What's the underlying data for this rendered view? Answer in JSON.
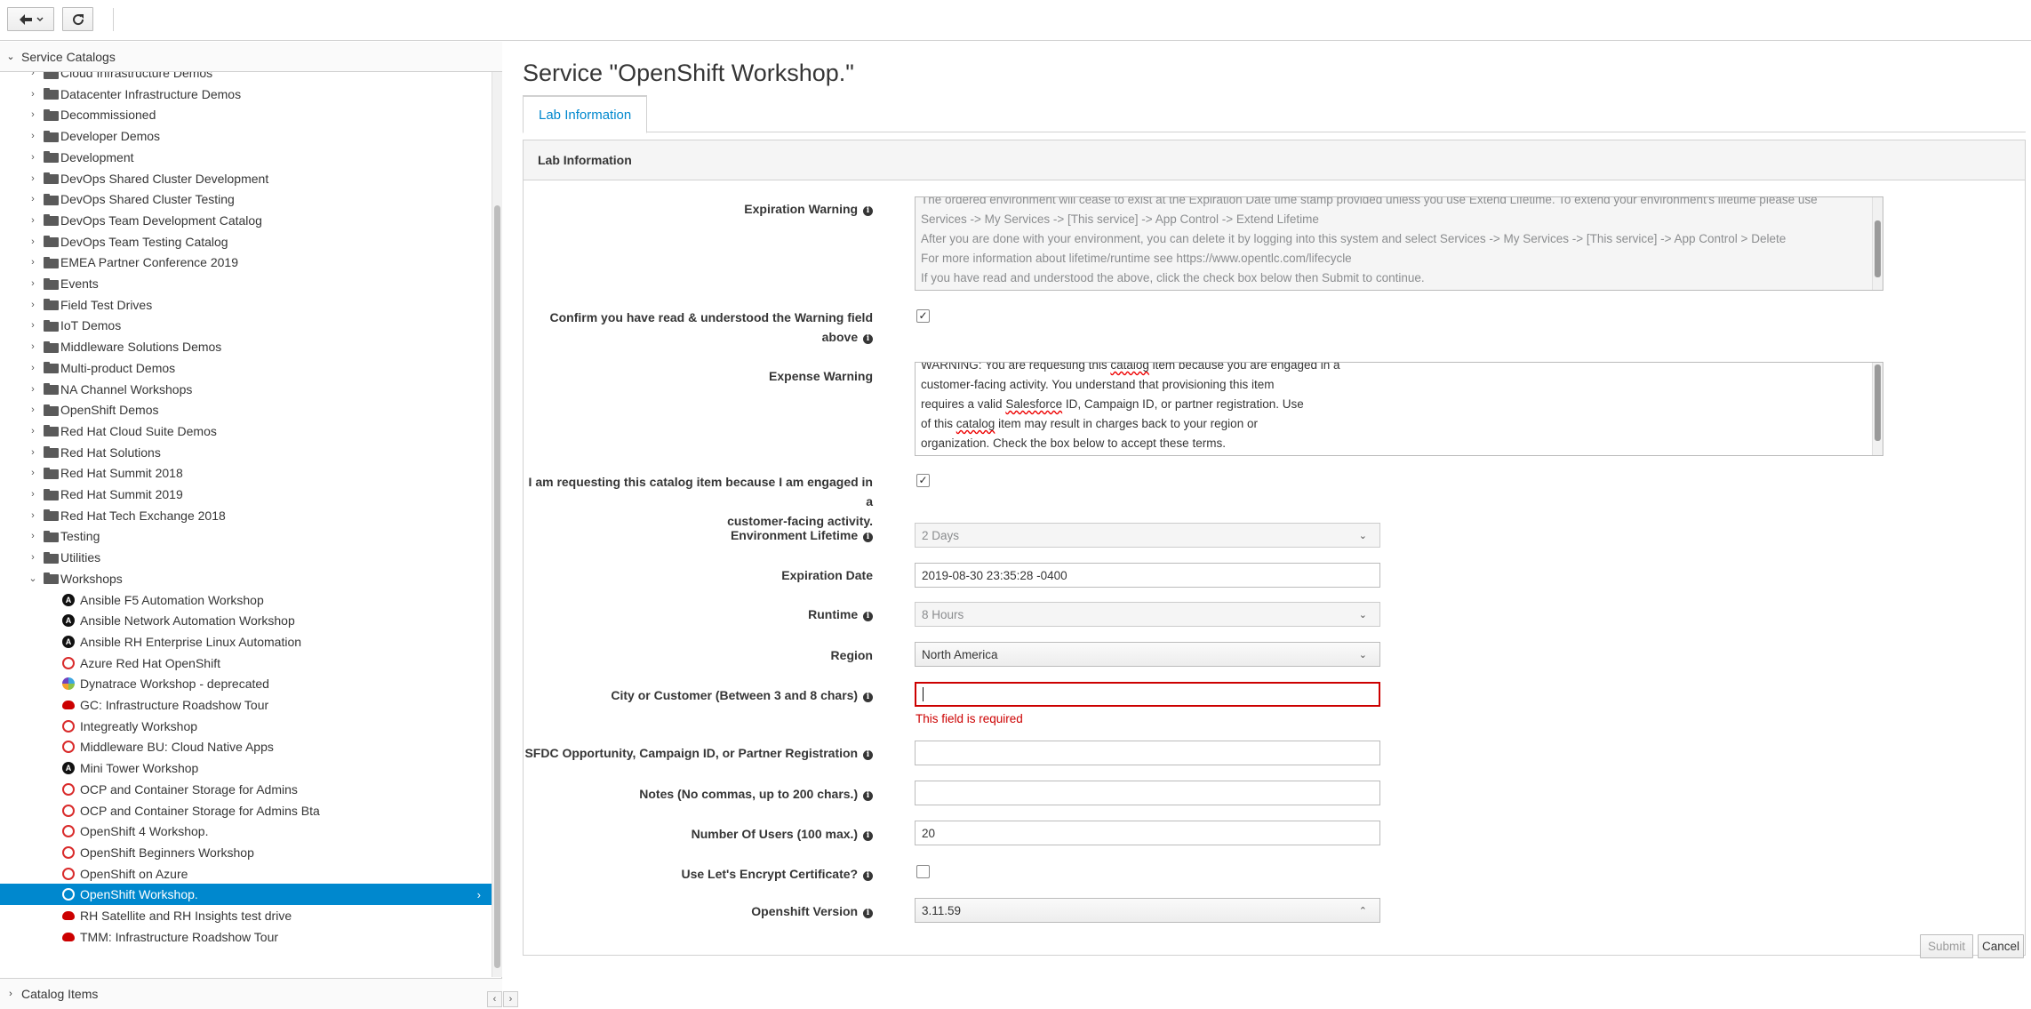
{
  "toolbar": {
    "back_icon": "arrow-left-icon",
    "refresh_icon": "refresh-icon"
  },
  "sidebar": {
    "accordion_title": "Service Catalogs",
    "tree_folders": [
      "Cloud Infrastructure Demos",
      "Datacenter Infrastructure Demos",
      "Decommissioned",
      "Developer Demos",
      "Development",
      "DevOps Shared Cluster Development",
      "DevOps Shared Cluster Testing",
      "DevOps Team Development Catalog",
      "DevOps Team Testing Catalog",
      "EMEA Partner Conference 2019",
      "Events",
      "Field Test Drives",
      "IoT Demos",
      "Middleware Solutions Demos",
      "Multi-product Demos",
      "NA Channel Workshops",
      "OpenShift Demos",
      "Red Hat Cloud Suite Demos",
      "Red Hat Solutions",
      "Red Hat Summit 2018",
      "Red Hat Summit 2019",
      "Red Hat Tech Exchange 2018",
      "Testing",
      "Utilities",
      "Workshops"
    ],
    "workshop_items": [
      {
        "label": "Ansible F5 Automation Workshop",
        "icon": "ansible"
      },
      {
        "label": "Ansible Network Automation Workshop",
        "icon": "ansible"
      },
      {
        "label": "Ansible RH Enterprise Linux Automation",
        "icon": "ansible"
      },
      {
        "label": "Azure Red Hat OpenShift",
        "icon": "openshift"
      },
      {
        "label": "Dynatrace Workshop - deprecated",
        "icon": "dyna"
      },
      {
        "label": "GC: Infrastructure Roadshow Tour",
        "icon": "hat"
      },
      {
        "label": "Integreatly Workshop",
        "icon": "openshift"
      },
      {
        "label": "Middleware BU: Cloud Native Apps",
        "icon": "openshift"
      },
      {
        "label": "Mini Tower Workshop",
        "icon": "ansible"
      },
      {
        "label": "OCP and Container Storage for Admins",
        "icon": "openshift"
      },
      {
        "label": "OCP and Container Storage for Admins Bta",
        "icon": "openshift"
      },
      {
        "label": "OpenShift 4 Workshop.",
        "icon": "openshift"
      },
      {
        "label": "OpenShift Beginners Workshop",
        "icon": "openshift"
      },
      {
        "label": "OpenShift on Azure",
        "icon": "openshift"
      },
      {
        "label": "OpenShift Workshop.",
        "icon": "openshift",
        "selected": true
      },
      {
        "label": "RH Satellite and RH Insights test drive",
        "icon": "hat"
      },
      {
        "label": "TMM: Infrastructure Roadshow Tour",
        "icon": "hat"
      }
    ],
    "footer_title": "Catalog Items"
  },
  "main": {
    "title": "Service \"OpenShift Workshop.\"",
    "tab": "Lab Information",
    "section_title": "Lab Information",
    "expiration_warning": {
      "label": "Expiration Warning",
      "lines": [
        "The ordered environment will cease to exist at the Expiration Date time stamp provided unless you use Extend Lifetime.  To extend your environment's lifetime please use",
        "Services -> My Services -> [This service] -> App Control -> Extend Lifetime",
        "After you are done with your environment, you can delete it by logging into this system and select Services -> My Services -> [This service] -> App Control > Delete",
        "For more information about lifetime/runtime see https://www.opentlc.com/lifecycle",
        "If you have read and understood the above, click the check box below then Submit to continue."
      ]
    },
    "confirm_warning": {
      "label_line1": "Confirm you have read & understood the Warning field",
      "label_line2": "above",
      "checked": "✓"
    },
    "expense_warning": {
      "label": "Expense Warning",
      "l1a": "WARNING: You are requesting this ",
      "l1b": "catalog",
      "l1c": " item because you are engaged in a",
      "l2": "customer-facing activity. You understand that provisioning this item",
      "l3a": "requires a valid ",
      "l3b": "Salesforce",
      "l3c": " ID, Campaign ID, or partner registration. Use",
      "l4a": "of this ",
      "l4b": "catalog",
      "l4c": " item may result in charges back to your region or",
      "l5": "organization. Check the box below to accept these terms."
    },
    "engaged": {
      "label_line1": "I am requesting this catalog item because I am engaged in a",
      "label_line2": "customer-facing activity.",
      "checked": "✓"
    },
    "env_lifetime": {
      "label": "Environment Lifetime",
      "value": "2 Days"
    },
    "expiration_date": {
      "label": "Expiration Date",
      "value": "2019-08-30 23:35:28 -0400"
    },
    "runtime": {
      "label": "Runtime",
      "value": "8 Hours"
    },
    "region": {
      "label": "Region",
      "value": "North America"
    },
    "city": {
      "label": "City or Customer (Between 3 and 8 chars)",
      "value": "",
      "error": "This field is required"
    },
    "sfdc": {
      "label": "SFDC Opportunity, Campaign ID, or Partner Registration",
      "value": ""
    },
    "notes": {
      "label": "Notes (No commas, up to 200 chars.)",
      "value": ""
    },
    "num_users": {
      "label": "Number Of Users (100 max.)",
      "value": "20"
    },
    "letsencrypt": {
      "label": "Use Let's Encrypt Certificate?"
    },
    "openshift_version": {
      "label": "Openshift Version",
      "value": "3.11.59"
    },
    "submit": "Submit",
    "cancel": "Cancel"
  }
}
